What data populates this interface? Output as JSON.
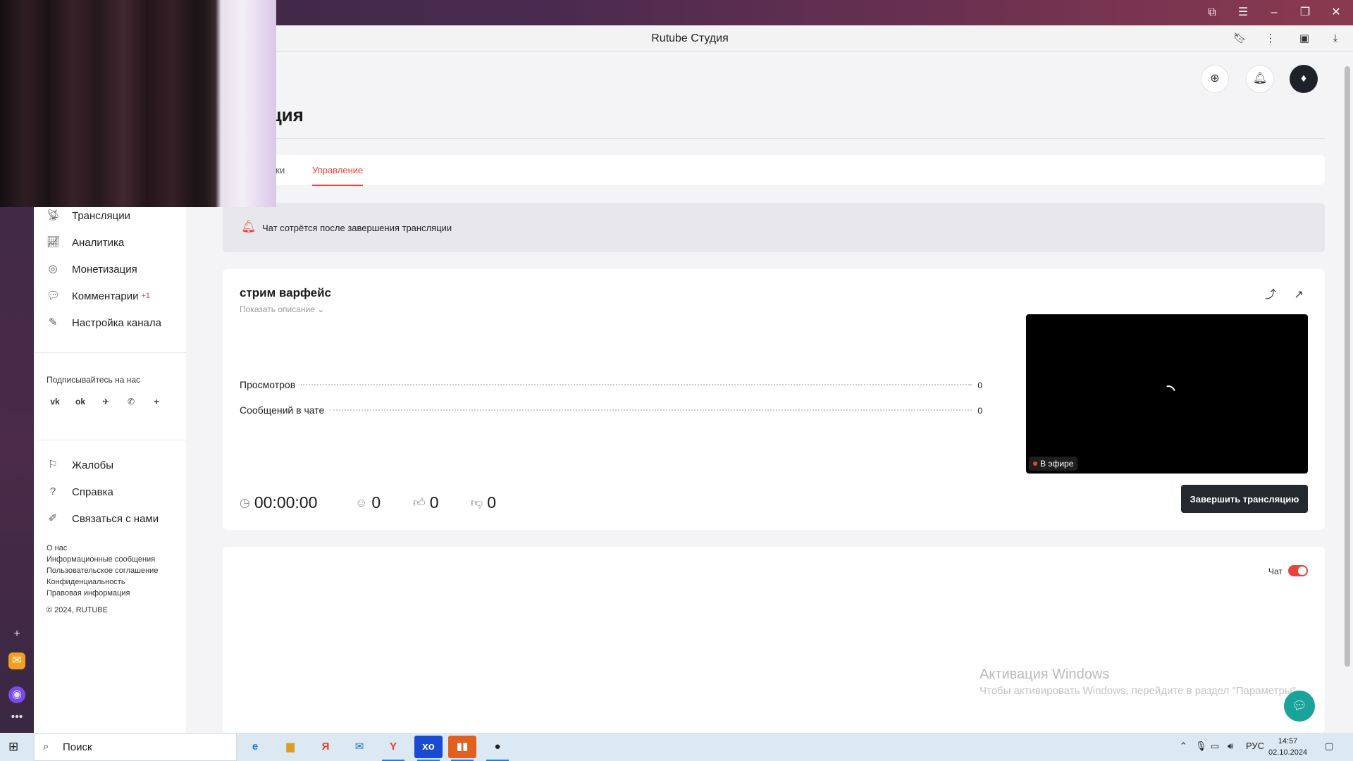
{
  "browser": {
    "page_title": "Rutube Студия"
  },
  "tabs": [
    {
      "label": "йки"
    },
    {
      "label": "Управление"
    }
  ],
  "heading": "ляция",
  "notice": "Чат сотрётся после завершения трансляции",
  "sidebar": {
    "items": [
      {
        "label": "Трансляции",
        "icon": "broadcast-icon"
      },
      {
        "label": "Аналитика",
        "icon": "analytics-icon"
      },
      {
        "label": "Монетизация",
        "icon": "coin-icon"
      },
      {
        "label": "Комментарии",
        "icon": "comments-icon",
        "badge": "+1"
      },
      {
        "label": "Настройка канала",
        "icon": "magic-wand-icon"
      }
    ],
    "follow_title": "Подписывайтесь на нас",
    "social": [
      "vk",
      "ok",
      "telegram",
      "viber",
      "more"
    ],
    "help_items": [
      {
        "label": "Жалобы",
        "icon": "flag-icon"
      },
      {
        "label": "Справка",
        "icon": "question-icon"
      },
      {
        "label": "Связаться с нами",
        "icon": "pencil-icon"
      }
    ],
    "footer_links": [
      "О нас",
      "Информационные сообщения",
      "Пользовательское соглашение",
      "Конфиденциальность",
      "Правовая информация"
    ],
    "copyright": "© 2024, RUTUBE"
  },
  "stream": {
    "title": "стрим варфейс",
    "show_description": "Показать описание",
    "stats": [
      {
        "label": "Просмотров",
        "value": "0"
      },
      {
        "label": "Сообщений в чате",
        "value": "0"
      }
    ],
    "live_label": "В эфире",
    "timer": "00:00:00",
    "viewers": "0",
    "likes": "0",
    "dislikes": "0",
    "end_button": "Завершить трансляцию"
  },
  "chat": {
    "label": "Чат",
    "enabled": true
  },
  "watermark": {
    "title": "Активация Windows",
    "subtitle": "Чтобы активировать Windows, перейдите в раздел \"Параметры\"."
  },
  "taskbar": {
    "search_placeholder": "Поиск",
    "language": "РУС",
    "time": "14:57",
    "date": "02.10.2024"
  },
  "colors": {
    "accent": "#e8433c",
    "dark_button": "#23292f",
    "fab": "#1aa39a"
  }
}
